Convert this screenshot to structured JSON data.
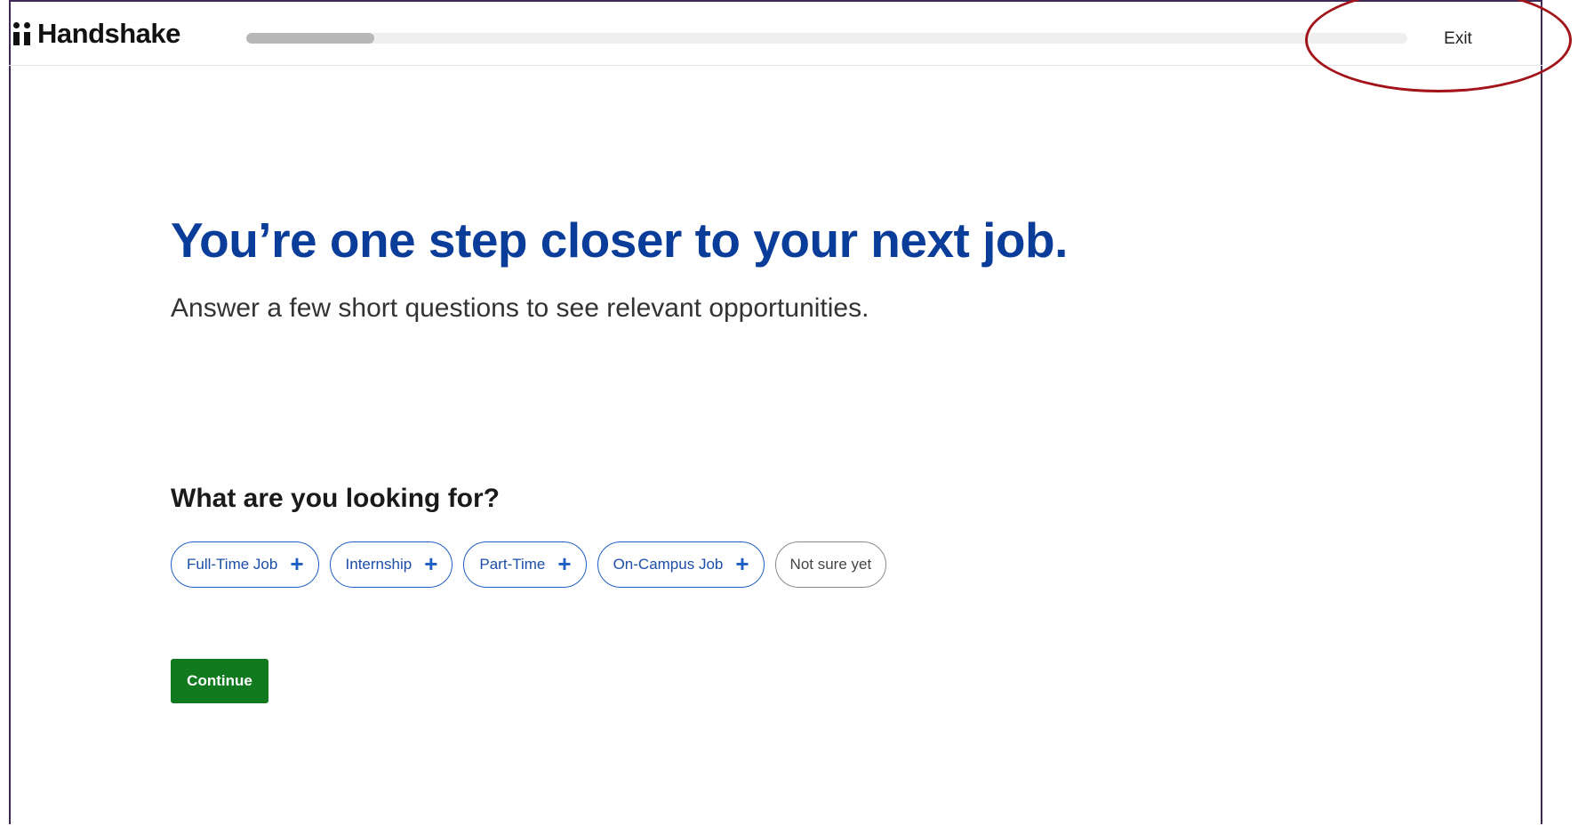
{
  "header": {
    "logo_text": "Handshake",
    "progress_fraction": 0.11,
    "exit_label": "Exit"
  },
  "main": {
    "headline": "You’re one step closer to your next job.",
    "subhead": "Answer a few short questions to see relevant opportunities.",
    "question": "What are you looking for?",
    "options": [
      {
        "label": "Full-Time Job",
        "icon": "plus-icon"
      },
      {
        "label": "Internship",
        "icon": "plus-icon"
      },
      {
        "label": "Part-Time",
        "icon": "plus-icon"
      },
      {
        "label": "On-Campus Job",
        "icon": "plus-icon"
      },
      {
        "label": "Not sure yet"
      }
    ],
    "continue_label": "Continue"
  },
  "colors": {
    "headline": "#0a3d99",
    "chip_border": "#1f5fc4",
    "continue_bg": "#117a1f",
    "annotation": "#a3141a",
    "frame": "#3f2a56"
  }
}
